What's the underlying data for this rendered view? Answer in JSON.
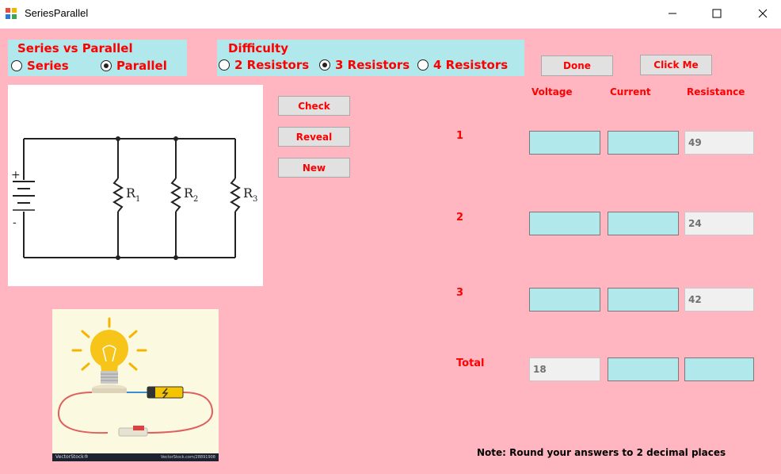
{
  "window": {
    "title": "SeriesParallel",
    "controls": {
      "minimize": "—",
      "maximize": "☐",
      "close": "✕"
    }
  },
  "mode_group": {
    "title": "Series vs Parallel",
    "options": [
      {
        "label": "Series",
        "selected": false
      },
      {
        "label": "Parallel",
        "selected": true
      }
    ]
  },
  "difficulty_group": {
    "title": "Difficulty",
    "options": [
      {
        "label": "2 Resistors",
        "selected": false
      },
      {
        "label": "3 Resistors",
        "selected": true
      },
      {
        "label": "4 Resistors",
        "selected": false
      }
    ]
  },
  "buttons": {
    "check": "Check",
    "reveal": "Reveal",
    "new": "New",
    "done": "Done",
    "click_me": "Click Me"
  },
  "table": {
    "headers": {
      "voltage": "Voltage",
      "current": "Current",
      "resistance": "Resistance"
    },
    "rows": [
      {
        "label": "1",
        "voltage": "",
        "current": "",
        "resistance": "49"
      },
      {
        "label": "2",
        "voltage": "",
        "current": "",
        "resistance": "24"
      },
      {
        "label": "3",
        "voltage": "",
        "current": "",
        "resistance": "42"
      },
      {
        "label": "Total",
        "voltage": "18",
        "current": "",
        "resistance": ""
      }
    ]
  },
  "circuit": {
    "plus": "+",
    "minus": "-",
    "resistors": [
      {
        "letter": "R",
        "index": "1"
      },
      {
        "letter": "R",
        "index": "2"
      },
      {
        "letter": "R",
        "index": "3"
      }
    ]
  },
  "image_caption": {
    "left": "VectorStock®",
    "right": "VectorStock.com/28891908"
  },
  "note": "Note: Round your answers to 2 decimal places",
  "colors": {
    "form_bg": "#ffb6c1",
    "group_bg": "#b0e8ec",
    "label_text": "#ff0000",
    "input_bg": "#b0e8ec"
  }
}
